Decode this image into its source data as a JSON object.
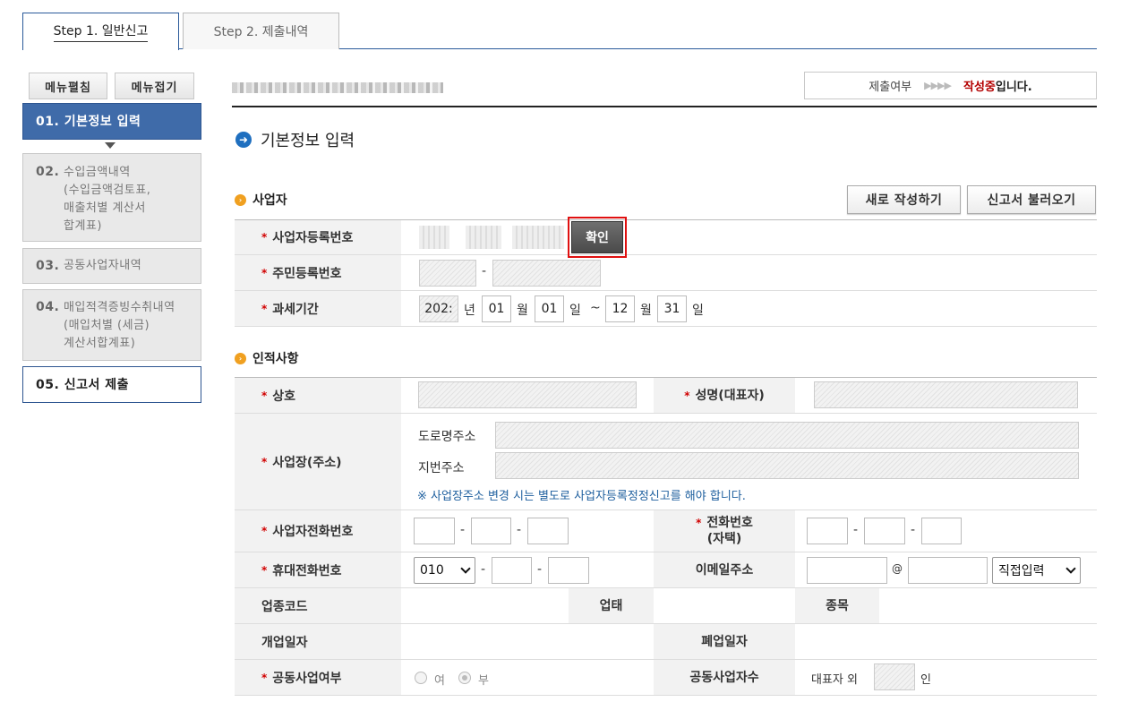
{
  "steps": [
    {
      "label": "Step 1. 일반신고"
    },
    {
      "label": "Step 2. 제출내역"
    }
  ],
  "sidebar": {
    "expand_label": "메뉴펼침",
    "collapse_label": "메뉴접기",
    "items": [
      {
        "num": "01.",
        "label": "기본정보 입력"
      },
      {
        "num": "02.",
        "label": "수입금액내역",
        "sub": [
          "(수입금액검토표,",
          "매출처별 계산서",
          "합계표)"
        ]
      },
      {
        "num": "03.",
        "label": "공동사업자내역"
      },
      {
        "num": "04.",
        "label": "매입적격증빙수취내역",
        "sub": [
          "(매입처별 (세금)",
          "계산서합계표)"
        ]
      },
      {
        "num": "05.",
        "label": "신고서 제출"
      }
    ]
  },
  "header": {
    "submit_label": "제출여부",
    "arrows": "▶▶▶▶",
    "status_value": "작성중",
    "status_suffix": "입니다."
  },
  "section_title": "기본정보 입력",
  "business": {
    "title": "사업자",
    "new_button": "새로 작성하기",
    "load_button": "신고서 불러오기",
    "reg_no_label": "사업자등록번호",
    "confirm_button": "확인",
    "resident_no_label": "주민등록번호",
    "period_label": "과세기간",
    "period": {
      "year": "202:",
      "year_unit": "년",
      "start_month": "01",
      "month_unit": "월",
      "start_day": "01",
      "day_unit": "일",
      "tilde": "~",
      "end_month": "12",
      "end_day": "31"
    }
  },
  "personal": {
    "title": "인적사항",
    "trade_name_label": "상호",
    "rep_name_label": "성명(대표자)",
    "address_label": "사업장(주소)",
    "road_address_label": "도로명주소",
    "lot_address_label": "지번주소",
    "address_notice": "※ 사업장주소 변경 시는 별도로 사업자등록정정신고를 해야 합니다.",
    "biz_phone_label": "사업자전화번호",
    "home_phone_label_1": "전화번호",
    "home_phone_label_2": "(자택)",
    "mobile_label": "휴대전화번호",
    "mobile_prefix": "010",
    "email_label": "이메일주소",
    "email_at": "@",
    "email_domain_option": "직접입력",
    "industry_code_label": "업종코드",
    "business_type_label": "업태",
    "item_label": "종목",
    "open_date_label": "개업일자",
    "close_date_label": "폐업일자",
    "joint_label": "공동사업여부",
    "joint_yes": "여",
    "joint_no": "부",
    "joint_count_label": "공동사업자수",
    "rep_extra": "대표자 외",
    "person_unit": "인",
    "dash": "-",
    "required_mark": "*"
  }
}
